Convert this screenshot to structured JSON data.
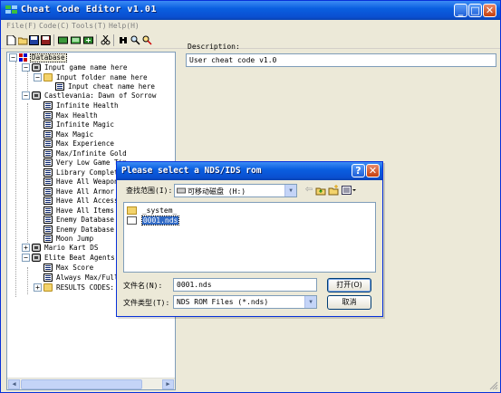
{
  "window": {
    "title": "Cheat Code Editor v1.01"
  },
  "menu": {
    "items": [
      "File(F)",
      "Code(C)",
      "Tools(T)",
      "Help(H)"
    ]
  },
  "toolbar": {
    "icons": [
      "new-icon",
      "open-icon",
      "save-icon",
      "save-as-icon",
      "add-game-icon",
      "add-folder-icon",
      "add-cheat-icon",
      "cut-icon",
      "find-icon",
      "find-next-icon",
      "replace-icon"
    ]
  },
  "tree": {
    "root": "Database",
    "game_placeholder": "Input game name here",
    "folder_placeholder": "Input folder name here",
    "cheat_placeholder": "Input cheat name here",
    "game1": "Castlevania: Dawn of Sorrow",
    "game1_cheats": [
      "Infinite Health",
      "Max Health",
      "Infinite Magic",
      "Max Magic",
      "Max Experience",
      "Max/Infinite Gold",
      "Very Low Game Tim",
      "Library Complete",
      "Have All Weapons",
      "Have All Armor",
      "Have All Accesso",
      "Have All Items",
      "Enemy Database Vi",
      "Enemy Database Co",
      "Moon Jump"
    ],
    "game2": "Mario Kart DS",
    "game3": "Elite Beat Agents",
    "game3_cheats": [
      "Max Score",
      "Always Max/Full B"
    ],
    "game3_folder": "RESULTS CODES:"
  },
  "description": {
    "label": "Description:",
    "value": "User cheat code v1.0"
  },
  "dialog": {
    "title": "Please select a NDS/IDS rom",
    "lookin_label": "查找范围(I):",
    "lookin_value": "可移动磁盘 (H:)",
    "files": [
      "_system_",
      "0001.nds"
    ],
    "filename_label": "文件名(N):",
    "filename_value": "0001.nds",
    "filetype_label": "文件类型(T):",
    "filetype_value": "NDS ROM Files (*.nds)",
    "open_label": "打开(O)",
    "cancel_label": "取消",
    "help_glyph": "?",
    "close_glyph": "✕"
  },
  "colors": {
    "titlebar": "#0a5fe0",
    "selection": "#316ac5",
    "dialog_bg": "#ece9d8"
  }
}
